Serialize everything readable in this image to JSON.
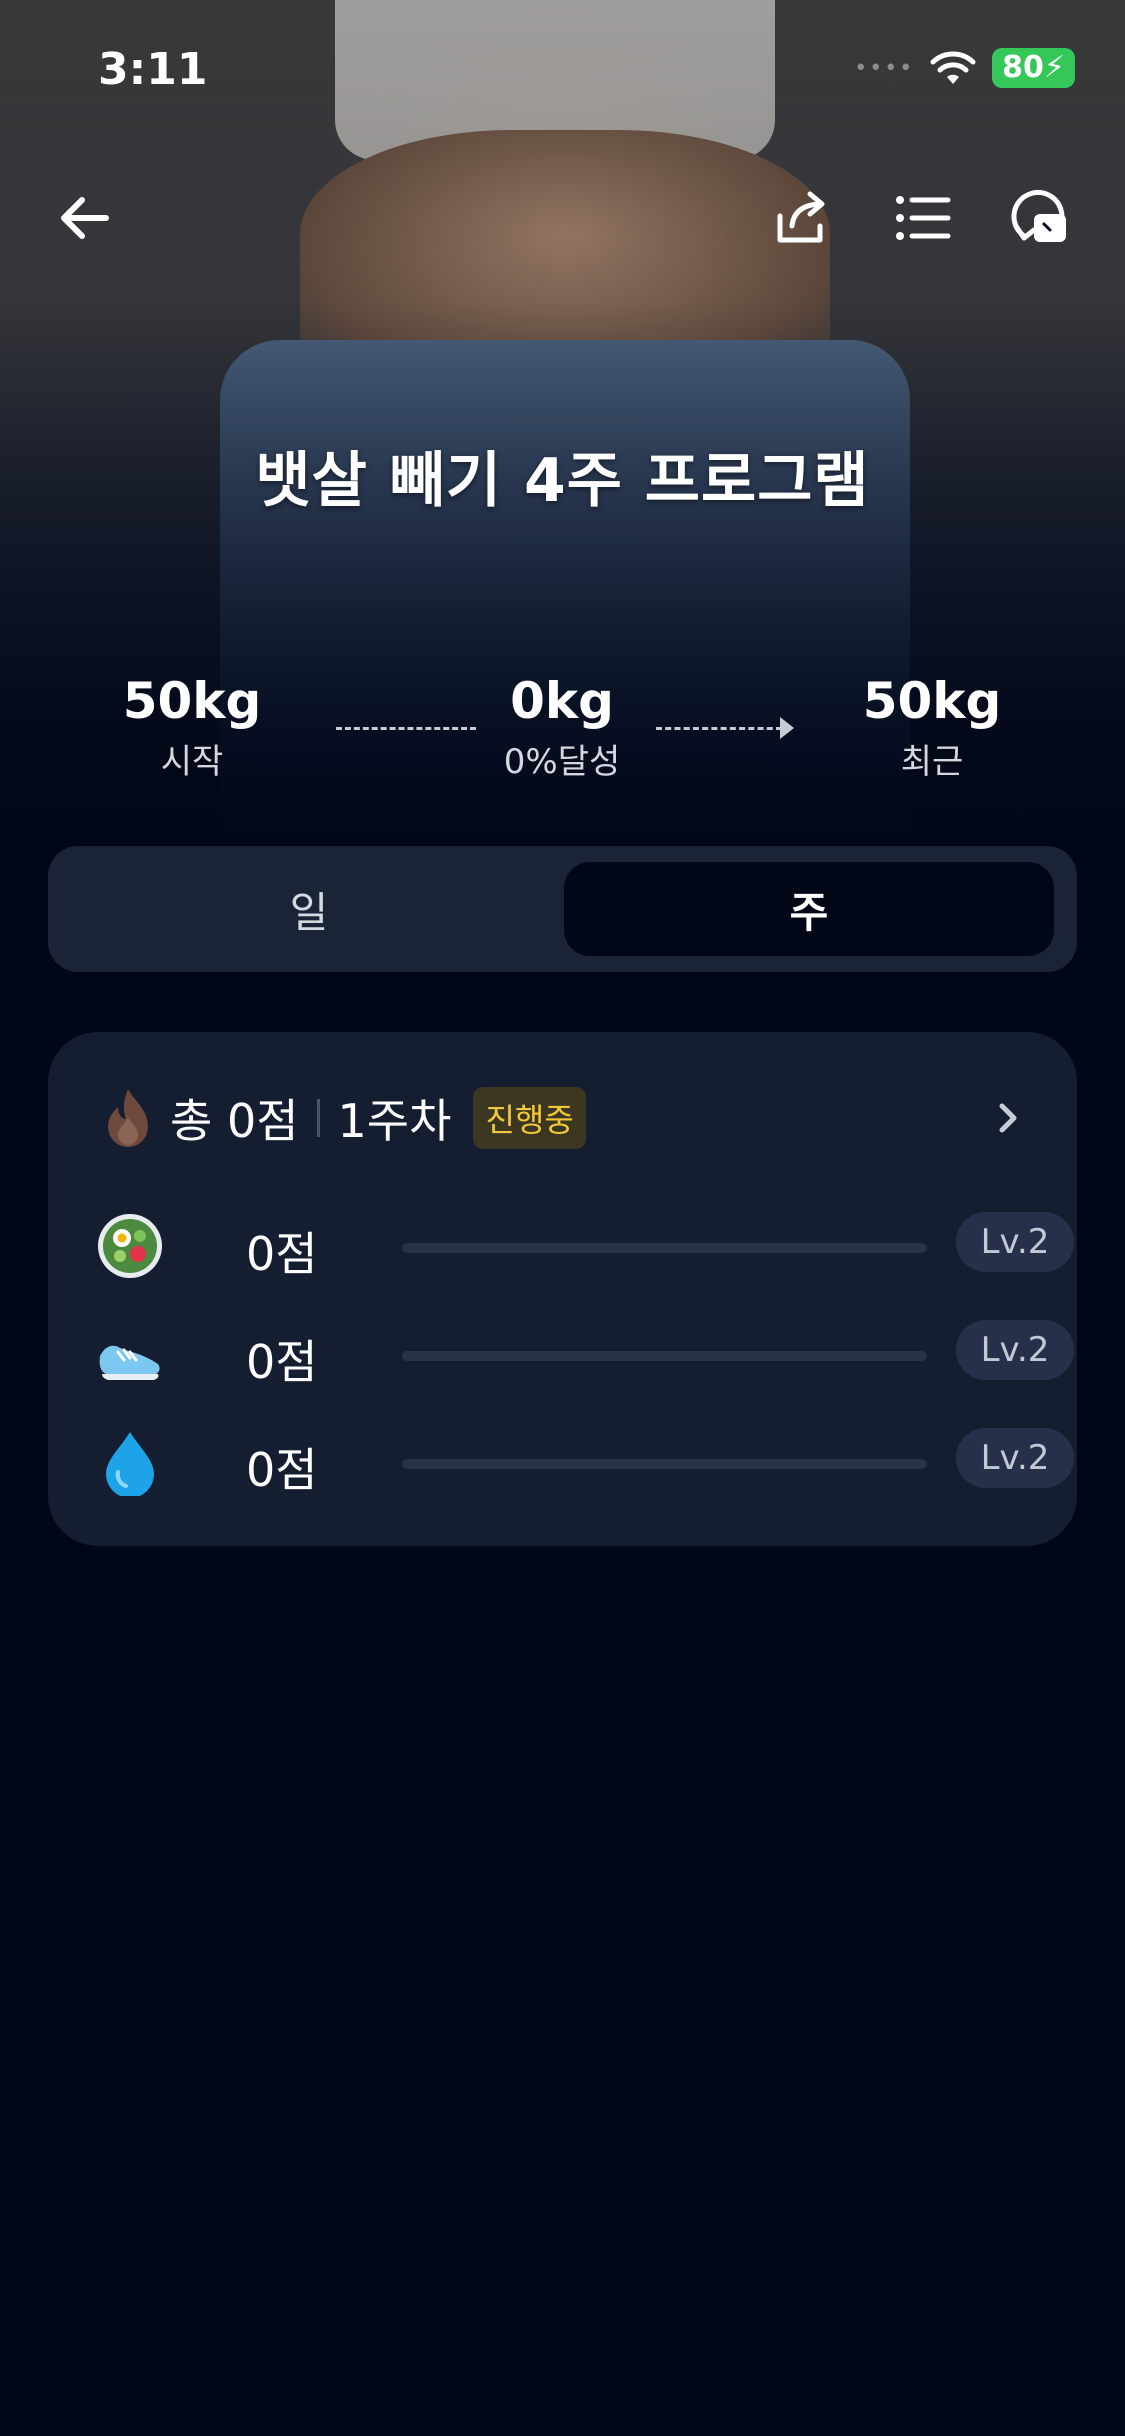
{
  "status_bar": {
    "time": "3:11",
    "signal": "••••",
    "battery": "80"
  },
  "program": {
    "title": "뱃살 빼기 4주 프로그램"
  },
  "stats": {
    "start": {
      "value": "50kg",
      "label": "시작"
    },
    "progress": {
      "value": "0kg",
      "label": "0%달성"
    },
    "recent": {
      "value": "50kg",
      "label": "최근"
    }
  },
  "tabs": {
    "day": "일",
    "week": "주",
    "selected": "week"
  },
  "summary": {
    "total": "총 0점",
    "week": "1주차",
    "status_badge": "진행중",
    "rows": [
      {
        "icon": "salad-icon",
        "score": "0점",
        "level": "Lv.2",
        "progress": 0
      },
      {
        "icon": "running-shoe-icon",
        "score": "0점",
        "level": "Lv.2",
        "progress": 0
      },
      {
        "icon": "water-drop-icon",
        "score": "0점",
        "level": "Lv.2",
        "progress": 0
      }
    ]
  },
  "colors": {
    "background": "#020718",
    "card": "#151d30",
    "badge_text": "#f3c83a",
    "battery": "#36c759"
  }
}
